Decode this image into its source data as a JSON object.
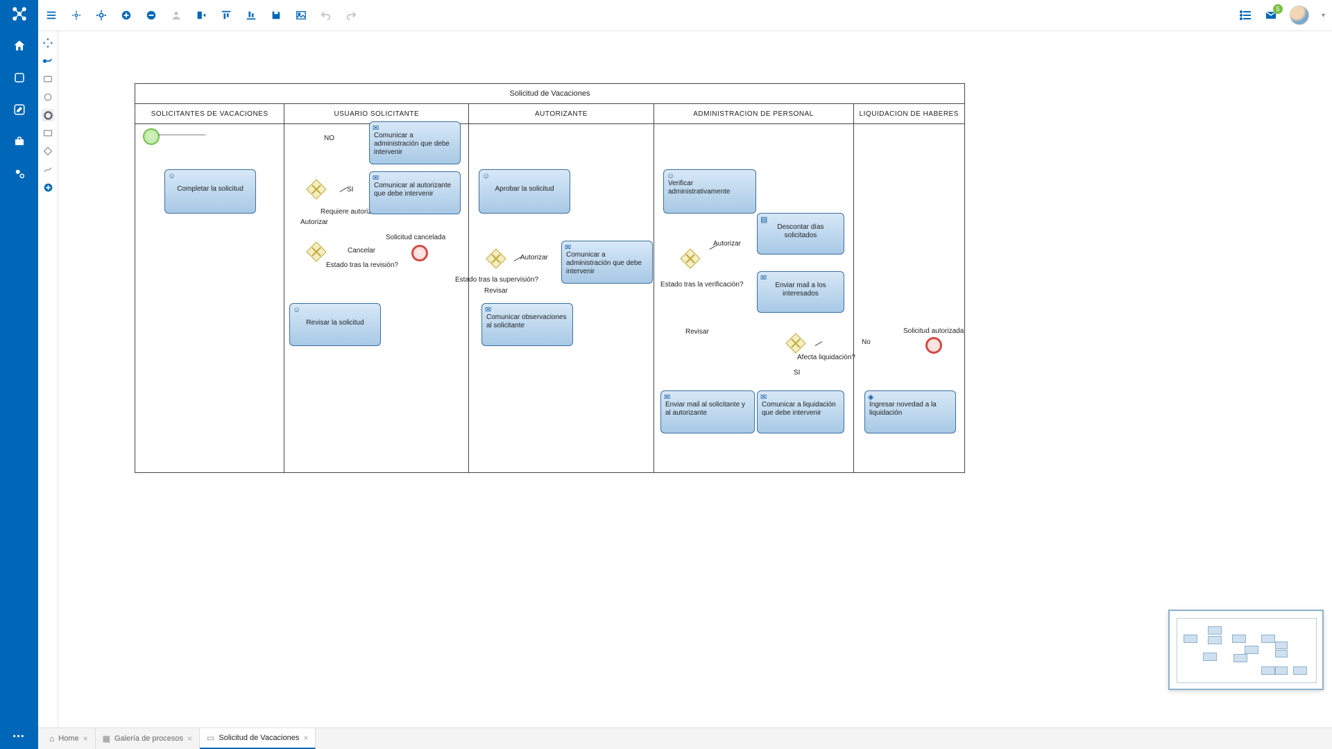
{
  "notifications_badge": "5",
  "pool_title": "Solicitud de Vacaciones",
  "lanes": [
    "SOLICITANTES DE VACACIONES",
    "USUARIO SOLICITANTE",
    "AUTORIZANTE",
    "ADMINISTRACION DE PERSONAL",
    "LIQUIDACION DE HABERES"
  ],
  "tasks": {
    "completar": "Completar la solicitud",
    "com_admin1": "Comunicar a administración que debe intervenir",
    "com_autoriz": "Comunicar al autorizante que debe intervenir",
    "revisar": "Revisar la solicitud",
    "aprobar": "Aprobar la solicitud",
    "com_admin2": "Comunicar a administración que debe intervenir",
    "com_obs": "Comunicar observaciones al solicitante",
    "verificar": "Verificar administrativamente",
    "descontar": "Descontar días solicitados",
    "mail_interes": "Enviar mail a los interesados",
    "mail_sol_aut": "Enviar mail al solicitante y al autorizante",
    "com_liq": "Comunicar a liquidación que debe intervenir",
    "ingresar": "Ingresar novedad a la liquidación"
  },
  "gateway_labels": {
    "g1": "Requiere autorización?",
    "g2": "Estado tras la revisión?",
    "g3": "Estado tras la supervisión?",
    "g4": "Estado tras la verificación?",
    "g5": "Afecta liquidación?"
  },
  "edge_labels": {
    "no1": "NO",
    "si1": "SI",
    "autorizar1": "Autorizar",
    "cancelar": "Cancelar",
    "sol_cancel": "Solicitud cancelada",
    "autorizar2": "Autorizar",
    "revisar2": "Revisar",
    "autorizar3": "Autorizar",
    "revisar3": "Revisar",
    "si2": "SI",
    "no2": "No",
    "sol_autoriz": "Solicitud autorizada"
  },
  "bottom_tabs": {
    "home": "Home",
    "galeria": "Galería de procesos",
    "solicitud": "Solicitud de Vacaciones"
  }
}
